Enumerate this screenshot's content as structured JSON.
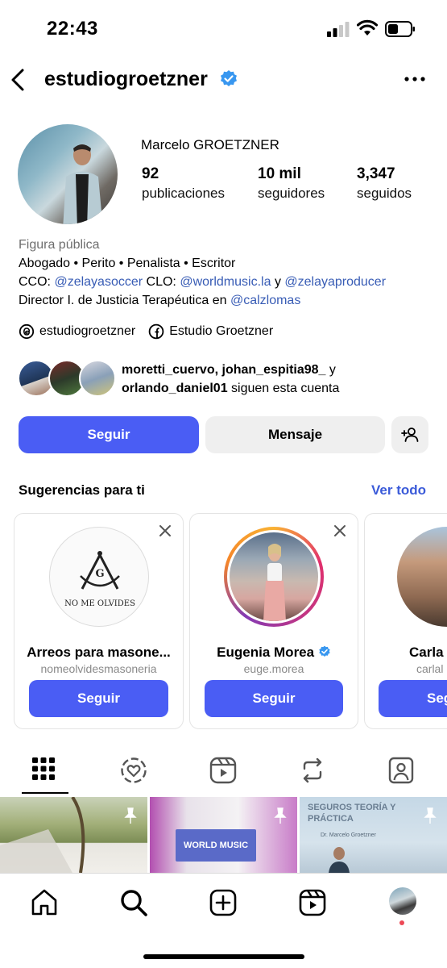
{
  "status_bar": {
    "time": "22:43"
  },
  "header": {
    "username": "estudiogroetzner",
    "verified_icon": "verified-badge-icon",
    "more_icon": "more-horizontal-icon",
    "back_icon": "chevron-left-icon"
  },
  "profile": {
    "display_name": "Marcelo GROETZNER",
    "stats": [
      {
        "value": "92",
        "label": "publicaciones"
      },
      {
        "value": "10 mil",
        "label": "seguidores"
      },
      {
        "value": "3,347",
        "label": "seguidos"
      }
    ],
    "category": "Figura pública",
    "bio_line1": "Abogado • Perito • Penalista • Escritor",
    "bio_line2": {
      "cco_label": "CCO:",
      "cco_handle": "@zelayasoccer",
      "clo_label": "CLO:",
      "clo_handle": "@worldmusic.la",
      "and": "y",
      "handle3": "@zelayaproducer"
    },
    "bio_line3": {
      "text": "Director I. de Justicia Terapéutica en",
      "handle": "@calzlomas"
    },
    "threads": "estudiogroetzner",
    "facebook": "Estudio Groetzner",
    "followed_by": {
      "user1": "moretti_cuervo,",
      "user2": "johan_espitia98_",
      "and": "y",
      "user3": "orlando_daniel01",
      "suffix": "siguen esta cuenta"
    }
  },
  "actions": {
    "follow": "Seguir",
    "message": "Mensaje",
    "add_user_icon": "add-person-icon"
  },
  "suggestions": {
    "title": "Sugerencias para ti",
    "see_all": "Ver todo",
    "cards": [
      {
        "name": "Arreos para masone...",
        "handle": "nomeolvidesmasoneria",
        "logo_text": "NO ME OLVIDES",
        "button": "Seguir"
      },
      {
        "name": "Eugenia Morea",
        "handle": "euge.morea",
        "button": "Seguir",
        "verified": true
      },
      {
        "name": "Carla",
        "handle": "carlal",
        "button": "Seg"
      }
    ]
  },
  "tabs": [
    "grid-icon",
    "reels-liked-icon",
    "reels-icon",
    "reposts-icon",
    "tagged-icon"
  ],
  "grid": [
    {
      "alt": "tree-photo"
    },
    {
      "label": "WORLD MUSIC"
    },
    {
      "title": "SEGUROS TEORÍA Y PRÁCTICA",
      "author": "Dr. Marcelo Groetzner"
    }
  ],
  "bottom_nav": [
    "home-icon",
    "search-icon",
    "create-icon",
    "reels-icon",
    "profile-avatar"
  ]
}
